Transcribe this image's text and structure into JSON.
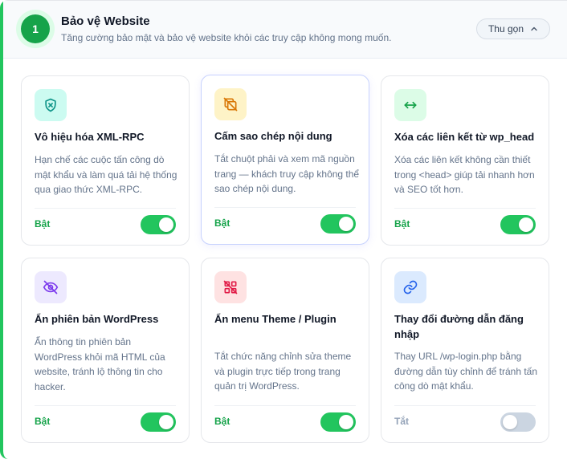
{
  "section": {
    "step": "1",
    "title": "Bảo vệ Website",
    "subtitle": "Tăng cường bảo mật và bảo vệ website khỏi các truy cập không mong muốn.",
    "collapse_label": "Thu gọn"
  },
  "cards": [
    {
      "title": "Vô hiệu hóa XML-RPC",
      "description": "Hạn chế các cuộc tấn công dò mật khẩu và làm quá tải hệ thống qua giao thức XML-RPC.",
      "status": "Bật",
      "enabled": true,
      "icon": "shield-x-icon",
      "icon_bg": "#ccfbf1",
      "icon_color": "#0d9488"
    },
    {
      "title": "Cấm sao chép nội dung",
      "description": "Tắt chuột phải và xem mã nguồn trang — khách truy cập không thể sao chép nội dung.",
      "status": "Bật",
      "enabled": true,
      "icon": "copy-off-icon",
      "icon_bg": "#fef3c7",
      "icon_color": "#d97706"
    },
    {
      "title": "Xóa các liên kết từ wp_head",
      "description": "Xóa các liên kết không cần thiết trong <head> giúp tải nhanh hơn và SEO tốt hơn.",
      "status": "Bật",
      "enabled": true,
      "icon": "arrows-horizontal-icon",
      "icon_bg": "#dcfce7",
      "icon_color": "#16a34a"
    },
    {
      "title": "Ẩn phiên bản WordPress",
      "description": "Ẩn thông tin phiên bản WordPress khỏi mã HTML của website, tránh lộ thông tin cho hacker.",
      "status": "Bật",
      "enabled": true,
      "icon": "eye-off-icon",
      "icon_bg": "#ede9fe",
      "icon_color": "#7c3aed"
    },
    {
      "title": "Ẩn menu Theme / Plugin",
      "description": "Tắt chức năng chỉnh sửa theme và plugin trực tiếp trong trang quản trị WordPress.",
      "status": "Bật",
      "enabled": true,
      "icon": "grid-off-icon",
      "icon_bg": "#fee2e2",
      "icon_color": "#e11d48"
    },
    {
      "title": "Thay đổi đường dẫn đăng nhập",
      "description": "Thay URL /wp-login.php bằng đường dẫn tùy chỉnh để tránh tấn công dò mật khẩu.",
      "status": "Tắt",
      "enabled": false,
      "icon": "link-icon",
      "icon_bg": "#dbeafe",
      "icon_color": "#2563eb"
    }
  ]
}
